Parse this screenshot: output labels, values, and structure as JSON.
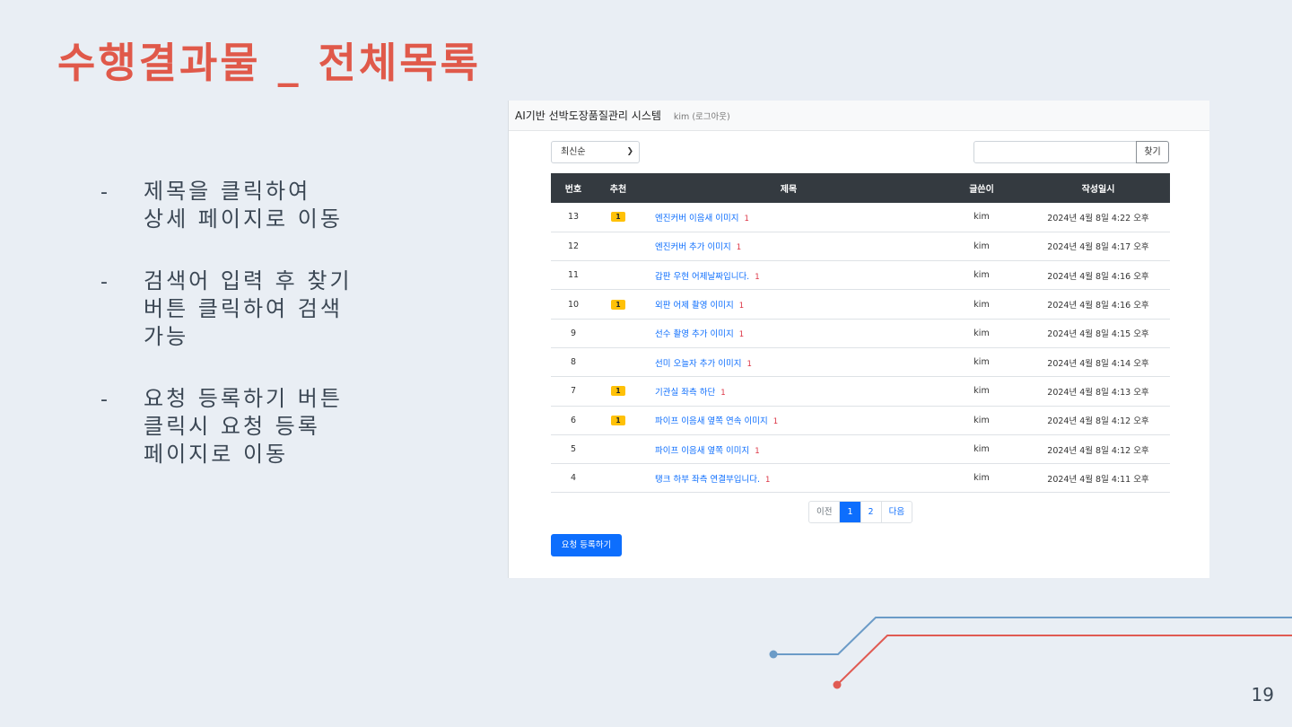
{
  "slide": {
    "title": "수행결과물 _ 전체목록",
    "bullets": [
      {
        "dash": "-",
        "text": "제목을 클릭하여\n상세 페이지로 이동"
      },
      {
        "dash": "-",
        "text": "검색어 입력 후 찾기\n버튼 클릭하여 검색\n가능"
      },
      {
        "dash": "-",
        "text": "요청 등록하기 버튼\n클릭시 요청 등록\n페이지로 이동"
      }
    ],
    "page_number": "19",
    "colors": {
      "title": "#e0594a",
      "line_blue": "#6b9bc7",
      "line_red": "#e05a52"
    }
  },
  "app": {
    "brand": "AI기반 선박도장품질관리 시스템",
    "user": "kim (로그아웃)",
    "sort": {
      "selected": "최신순"
    },
    "search": {
      "value": "",
      "button_label": "찾기"
    },
    "table": {
      "headers": [
        "번호",
        "추천",
        "제목",
        "글쓴이",
        "작성일시"
      ],
      "rows": [
        {
          "no": "13",
          "rec": "1",
          "title": "엔진커버 이음새 이미지",
          "comments": "1",
          "author": "kim",
          "date": "2024년 4월 8일 4:22 오후"
        },
        {
          "no": "12",
          "rec": "",
          "title": "엔진커버 추가 이미지",
          "comments": "1",
          "author": "kim",
          "date": "2024년 4월 8일 4:17 오후"
        },
        {
          "no": "11",
          "rec": "",
          "title": "갑판 우현 어제날짜입니다.",
          "comments": "1",
          "author": "kim",
          "date": "2024년 4월 8일 4:16 오후"
        },
        {
          "no": "10",
          "rec": "1",
          "title": "외판 어제 촬영 이미지",
          "comments": "1",
          "author": "kim",
          "date": "2024년 4월 8일 4:16 오후"
        },
        {
          "no": "9",
          "rec": "",
          "title": "선수 촬영 추가 이미지",
          "comments": "1",
          "author": "kim",
          "date": "2024년 4월 8일 4:15 오후"
        },
        {
          "no": "8",
          "rec": "",
          "title": "선미 오늘자 추가 이미지",
          "comments": "1",
          "author": "kim",
          "date": "2024년 4월 8일 4:14 오후"
        },
        {
          "no": "7",
          "rec": "1",
          "title": "기관실 좌측 하단",
          "comments": "1",
          "author": "kim",
          "date": "2024년 4월 8일 4:13 오후"
        },
        {
          "no": "6",
          "rec": "1",
          "title": "파이프 이음새 옆쪽 연속 이미지",
          "comments": "1",
          "author": "kim",
          "date": "2024년 4월 8일 4:12 오후"
        },
        {
          "no": "5",
          "rec": "",
          "title": "파이프 이음새 옆쪽 이미지",
          "comments": "1",
          "author": "kim",
          "date": "2024년 4월 8일 4:12 오후"
        },
        {
          "no": "4",
          "rec": "",
          "title": "탱크 하부 좌측 연결부입니다.",
          "comments": "1",
          "author": "kim",
          "date": "2024년 4월 8일 4:11 오후"
        }
      ]
    },
    "pagination": {
      "prev": "이전",
      "pages": [
        "1",
        "2"
      ],
      "active": "1",
      "next": "다음"
    },
    "register_button": "요청 등록하기"
  }
}
